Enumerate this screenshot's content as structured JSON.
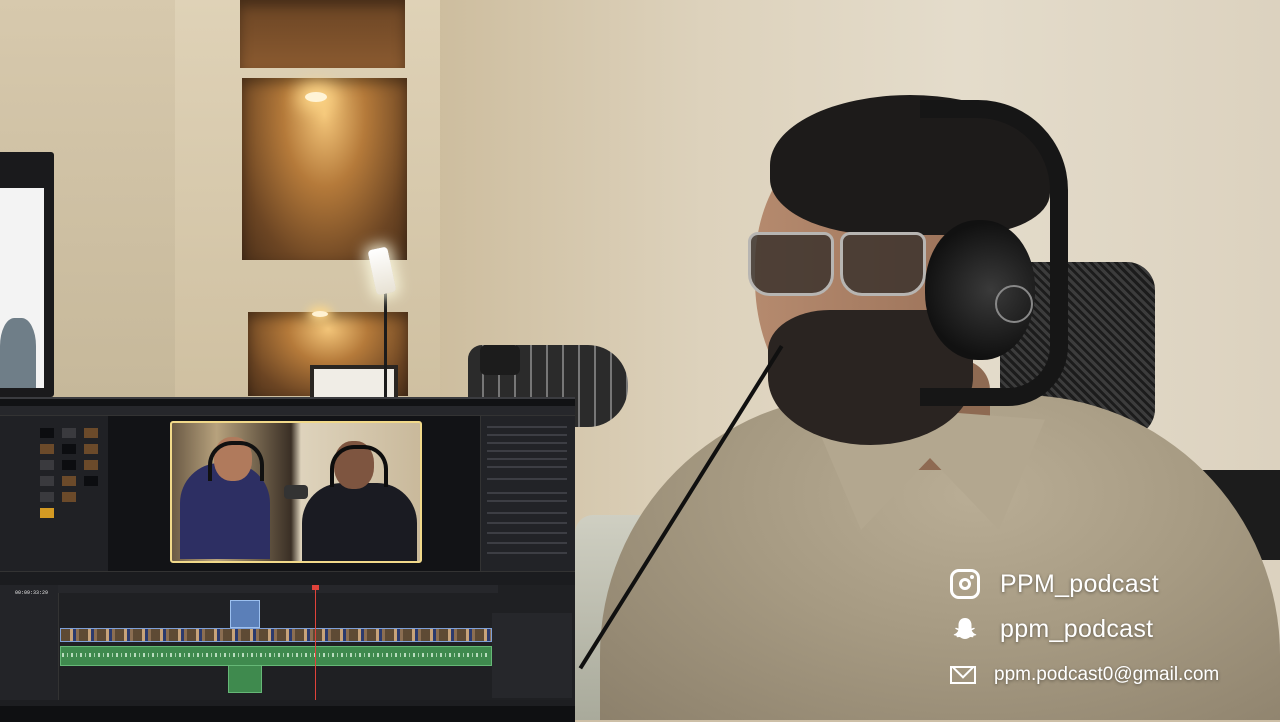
{
  "editor": {
    "timecode": "00:09:33:29"
  },
  "social": {
    "instagram": {
      "icon": "instagram-icon",
      "handle": "PPM_podcast"
    },
    "snapchat": {
      "icon": "snapchat-icon",
      "handle": "ppm_podcast"
    },
    "email": {
      "icon": "mail-icon",
      "address": "ppm.podcast0@gmail.com"
    }
  },
  "colors": {
    "overlay_text": "#ffffff",
    "viewer_frame": "#f1d98a",
    "playhead": "#e0433b",
    "audio_track": "#3f8a4e",
    "video_track_border": "#7ea0d8"
  }
}
